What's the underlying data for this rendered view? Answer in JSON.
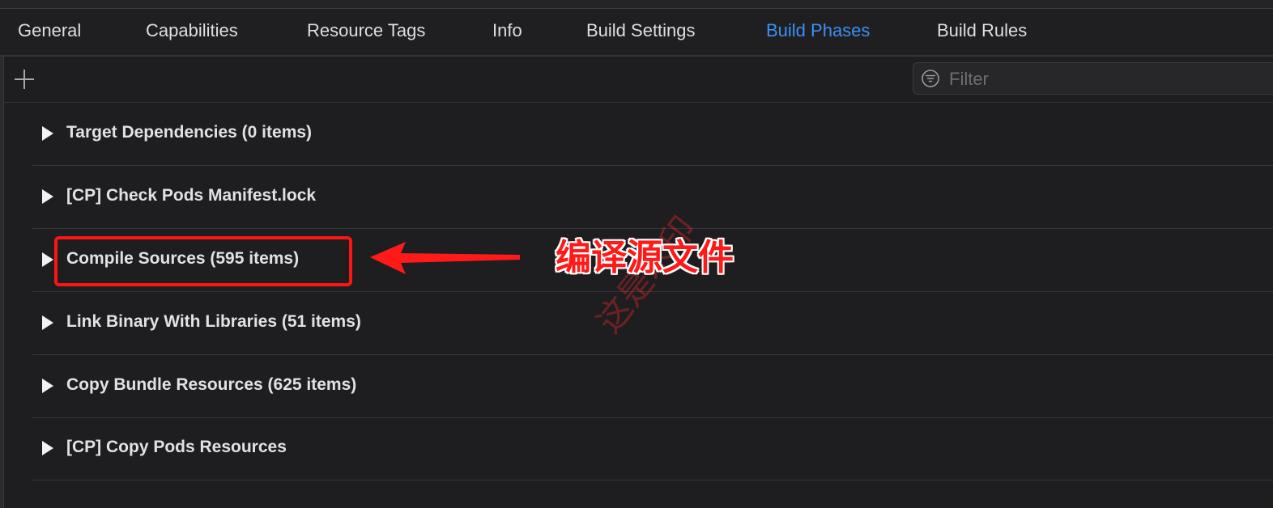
{
  "tabs": [
    {
      "label": "General",
      "active": false
    },
    {
      "label": "Capabilities",
      "active": false
    },
    {
      "label": "Resource Tags",
      "active": false
    },
    {
      "label": "Info",
      "active": false
    },
    {
      "label": "Build Settings",
      "active": false
    },
    {
      "label": "Build Phases",
      "active": true
    },
    {
      "label": "Build Rules",
      "active": false
    }
  ],
  "toolbar": {
    "add_icon": "plus-icon",
    "filter_icon": "filter-icon",
    "filter_placeholder": "Filter",
    "filter_value": ""
  },
  "phases": [
    {
      "label": "Target Dependencies (0 items)",
      "expanded": false
    },
    {
      "label": "[CP] Check Pods Manifest.lock",
      "expanded": false
    },
    {
      "label": "Compile Sources (595 items)",
      "expanded": false
    },
    {
      "label": "Link Binary With Libraries (51 items)",
      "expanded": false
    },
    {
      "label": "Copy Bundle Resources (625 items)",
      "expanded": false
    },
    {
      "label": "[CP] Copy Pods Resources",
      "expanded": false
    }
  ],
  "annotation": {
    "text": "编译源文件",
    "watermark": "这是水印",
    "color": "#ff1a1a"
  },
  "colors": {
    "background": "#1e1e21",
    "accent": "#3d8ff0",
    "text": "#dfdfe0"
  }
}
